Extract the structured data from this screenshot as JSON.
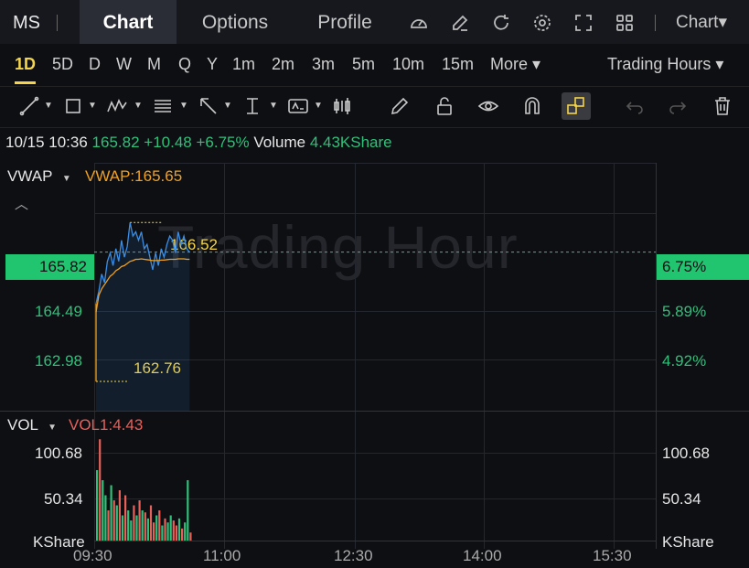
{
  "topbar": {
    "symbol": "MS",
    "tabs": [
      "Chart",
      "Options",
      "Profile"
    ],
    "chart_menu": "Chart▾"
  },
  "timeframes": {
    "items": [
      "1D",
      "5D",
      "D",
      "W",
      "M",
      "Q",
      "Y",
      "1m",
      "2m",
      "3m",
      "5m",
      "10m",
      "15m"
    ],
    "active": "1D",
    "more": "More ▾",
    "session": "Trading Hours ▾"
  },
  "info": {
    "datetime": "10/15 10:36",
    "price": "165.82",
    "change": "+10.48",
    "change_pct": "+6.75%",
    "volume_label": "Volume",
    "volume": "4.43KShare"
  },
  "price_panel": {
    "indicator": "VWAP",
    "indicator_value": "VWAP:165.65",
    "watermark": "Trading Hour",
    "current_price": "165.82",
    "current_pct": "6.75%",
    "left_ticks": [
      "164.49",
      "162.98"
    ],
    "right_ticks": [
      "5.89%",
      "4.92%"
    ],
    "high_label": "166.52",
    "low_label": "162.76"
  },
  "volume_panel": {
    "indicator": "VOL",
    "indicator_value": "VOL1:4.43",
    "left_ticks": [
      "100.68",
      "50.34",
      "KShare"
    ],
    "right_ticks": [
      "100.68",
      "50.34",
      "KShare"
    ]
  },
  "x_axis": [
    "09:30",
    "11:00",
    "12:30",
    "14:00",
    "15:30"
  ],
  "colors": {
    "up": "#30c07a",
    "down": "#e8605a",
    "line": "#3a8ee6",
    "vwap": "#f0a020",
    "accent": "#f5d547"
  },
  "chart_data": [
    {
      "type": "line",
      "x": [
        "09:30",
        "09:32",
        "09:34",
        "09:36",
        "09:38",
        "09:40",
        "09:42",
        "09:44",
        "09:46",
        "09:48",
        "09:50",
        "09:52",
        "09:54",
        "09:56",
        "09:58",
        "10:00",
        "10:02",
        "10:04",
        "10:06",
        "10:08",
        "10:10",
        "10:12",
        "10:14",
        "10:16",
        "10:18",
        "10:20",
        "10:22",
        "10:24",
        "10:26",
        "10:28",
        "10:30",
        "10:32",
        "10:34",
        "10:36"
      ],
      "series": [
        {
          "name": "Price",
          "values": [
            164.6,
            164.9,
            165.3,
            165.1,
            165.6,
            165.8,
            165.5,
            165.9,
            165.6,
            166.1,
            165.7,
            165.95,
            166.52,
            166.2,
            166.3,
            166.1,
            166.3,
            165.9,
            166.0,
            165.7,
            165.4,
            165.8,
            165.5,
            165.9,
            165.7,
            166.0,
            166.2,
            166.1,
            165.8,
            166.3,
            166.0,
            166.2,
            165.9,
            165.82
          ]
        },
        {
          "name": "VWAP",
          "values": [
            164.4,
            164.8,
            164.95,
            165.05,
            165.15,
            165.25,
            165.3,
            165.38,
            165.42,
            165.48,
            165.5,
            165.55,
            165.6,
            165.62,
            165.65,
            165.65,
            165.66,
            165.65,
            165.64,
            165.63,
            165.62,
            165.62,
            165.62,
            165.63,
            165.63,
            165.64,
            165.65,
            165.65,
            165.65,
            165.66,
            165.66,
            165.66,
            165.65,
            165.65
          ]
        }
      ],
      "xlim": [
        "09:30",
        "16:00"
      ],
      "ylim": [
        162.5,
        167.5
      ]
    },
    {
      "type": "bar",
      "values": [
        70,
        100.68,
        60,
        45,
        30,
        55,
        40,
        35,
        50,
        25,
        45,
        30,
        20,
        35,
        25,
        40,
        30,
        28,
        22,
        35,
        18,
        25,
        30,
        15,
        22,
        18,
        25,
        20,
        15,
        22,
        12,
        18,
        60,
        8
      ],
      "up": [
        true,
        false,
        true,
        true,
        false,
        true,
        false,
        true,
        false,
        true,
        false,
        true,
        true,
        false,
        true,
        false,
        true,
        false,
        true,
        false,
        false,
        true,
        false,
        true,
        false,
        true,
        true,
        false,
        false,
        true,
        false,
        true,
        true,
        false
      ],
      "ylim": [
        0,
        110
      ]
    }
  ]
}
